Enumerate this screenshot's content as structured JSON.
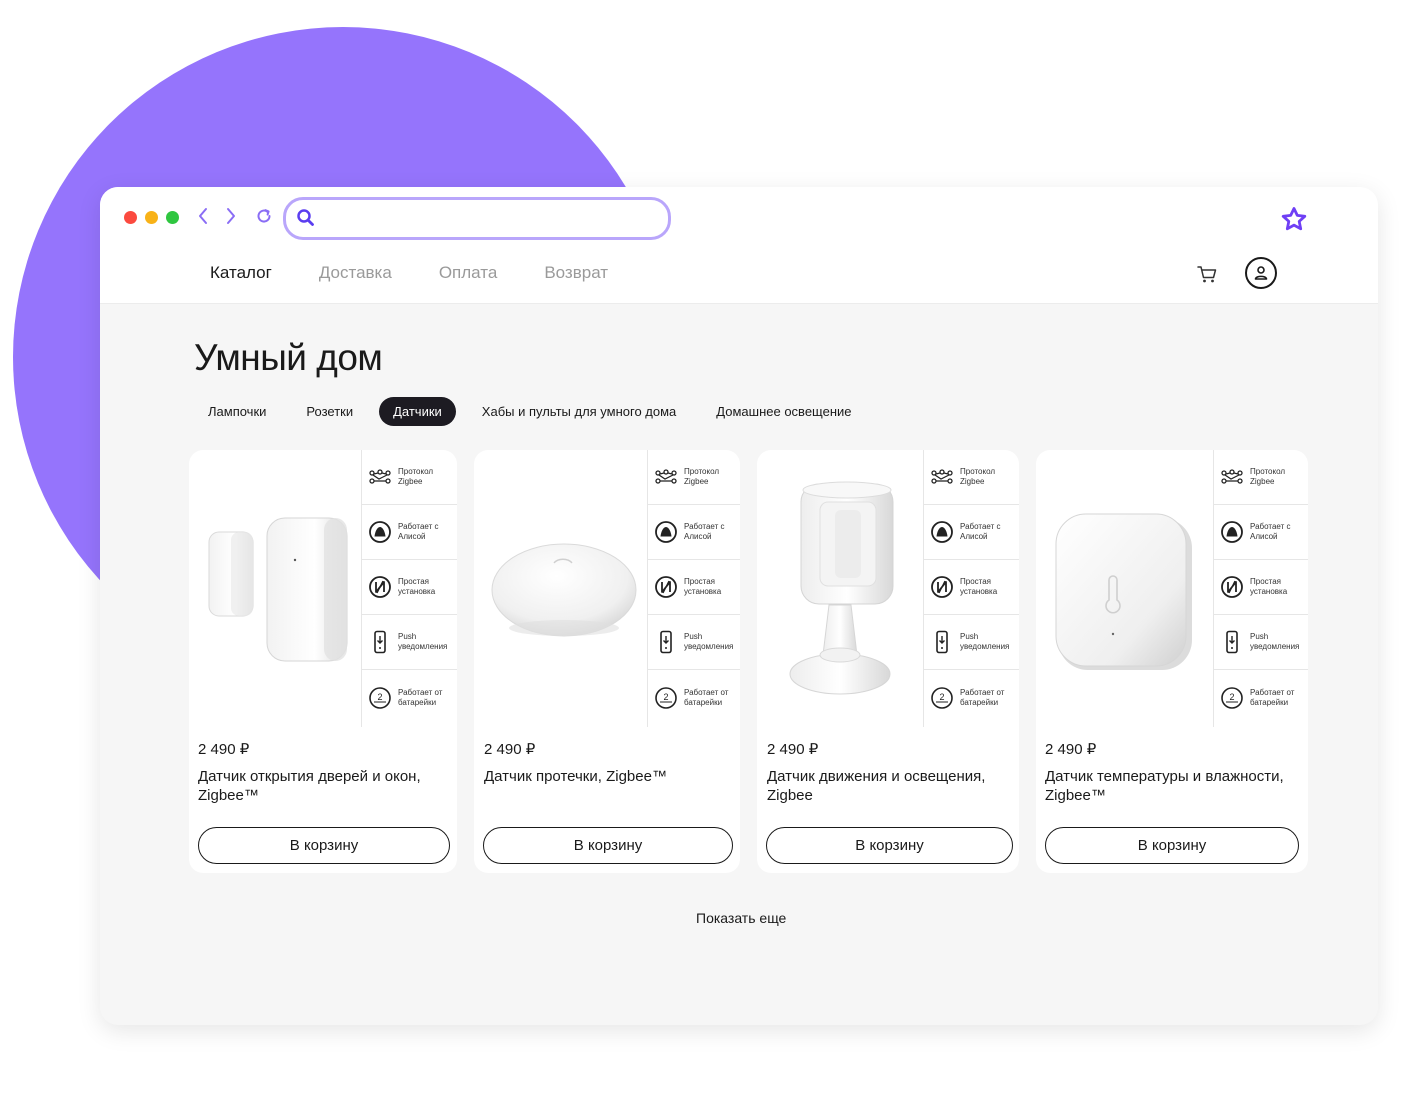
{
  "colors": {
    "accent": "#9574fc",
    "dark_pill": "#1d1b22",
    "red": "#fb4a3f",
    "yellow": "#f8b218",
    "green": "#2fc640"
  },
  "browser": {
    "search": {
      "value": "",
      "icon": "search-icon"
    },
    "favorite_icon": "star-icon"
  },
  "nav": {
    "items": [
      {
        "label": "Каталог",
        "active": true
      },
      {
        "label": "Доставка",
        "active": false
      },
      {
        "label": "Оплата",
        "active": false
      },
      {
        "label": "Возврат",
        "active": false
      }
    ],
    "cart_icon": "cart-icon",
    "profile_icon": "user-icon"
  },
  "page": {
    "title": "Умный дом",
    "categories": [
      {
        "label": "Лампочки",
        "active": false
      },
      {
        "label": "Розетки",
        "active": false
      },
      {
        "label": "Датчики",
        "active": true
      },
      {
        "label": "Хабы и пульты для умного дома",
        "active": false
      },
      {
        "label": "Домашнее освещение",
        "active": false
      }
    ],
    "features": [
      {
        "icon": "network-icon",
        "text": "Протокол Zigbee"
      },
      {
        "icon": "alice-icon",
        "text": "Работает с Алисой"
      },
      {
        "icon": "setup-icon",
        "text": "Простая установка"
      },
      {
        "icon": "phone-icon",
        "text": "Push уведомления"
      },
      {
        "icon": "battery-icon",
        "text": "Работает от батарейки"
      }
    ],
    "products": [
      {
        "price": "2 490 ₽",
        "name": "Датчик открытия дверей и окон, Zigbee™",
        "button": "В корзину"
      },
      {
        "price": "2 490 ₽",
        "name": "Датчик протечки, Zigbee™",
        "button": "В корзину"
      },
      {
        "price": "2 490 ₽",
        "name": "Датчик движения и освещения, Zigbee",
        "button": "В корзину"
      },
      {
        "price": "2 490 ₽",
        "name": "Датчик температуры и влажности, Zigbee™",
        "button": "В корзину"
      }
    ],
    "show_more": "Показать еще"
  }
}
